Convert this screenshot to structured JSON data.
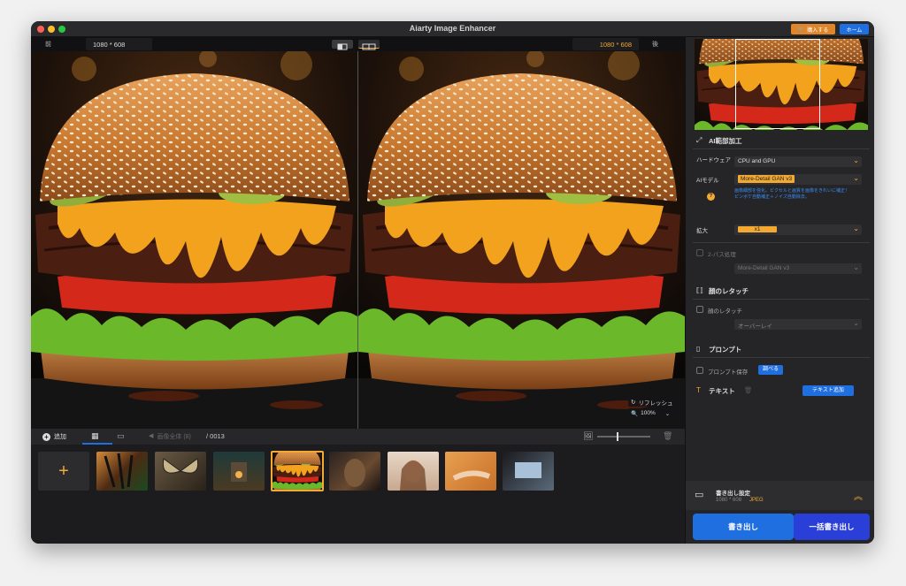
{
  "app_title": "Aiarty Image Enhancer",
  "header": {
    "buy_label": "購入する",
    "home_label": "ホーム"
  },
  "viewer": {
    "before_label": "前",
    "after_label": "後",
    "res_left": "1080 * 608",
    "res_right": "1080 * 608",
    "refresh_label": "リフレッシュ",
    "zoom": "100%"
  },
  "toolbar": {
    "add_label": "追加",
    "count_label": "画像全体 (8)",
    "total": "/ 0013"
  },
  "filmstrip": {
    "add_symbol": "+",
    "thumbnails": [
      "tiger",
      "butterfly",
      "cabin",
      "burger",
      "dog",
      "portrait",
      "hand",
      "laptop"
    ]
  },
  "panel": {
    "ai_section": "AI範部加工",
    "hardware_label": "ハードウェア",
    "hardware_value": "CPU and GPU",
    "model_label": "AIモデル",
    "model_value": "More-Detail GAN v3",
    "model_desc_1": "画像細部を強化。ピクセルと画質を画像をきれいに補正！",
    "model_desc_2": "ピンボケ自動補正＋ノイズ自動除去。",
    "scale_label": "拡大",
    "scale_value": "x1",
    "twopass_label": "2-パス処理",
    "twopass_model": "More-Detail GAN v3",
    "face_section": "顔のレタッチ",
    "face_label": "顔のレタッチ",
    "face_mode": "オーバーレイ",
    "prompt_section": "プロンプト",
    "prompt_save_label": "プロンプト保存",
    "prompt_check_btn": "調べる",
    "text_section": "テキスト",
    "text_add_btn": "テキスト追加",
    "export_title": "書き出し設定",
    "export_info_res": "1080 * 608",
    "export_info_fmt": "JPEG",
    "export_btn": "書き出し",
    "batch_export_btn": "一括書き出し"
  },
  "colors": {
    "accent": "#f4a933",
    "blue": "#1f6fe0",
    "buy": "#e0862a"
  }
}
